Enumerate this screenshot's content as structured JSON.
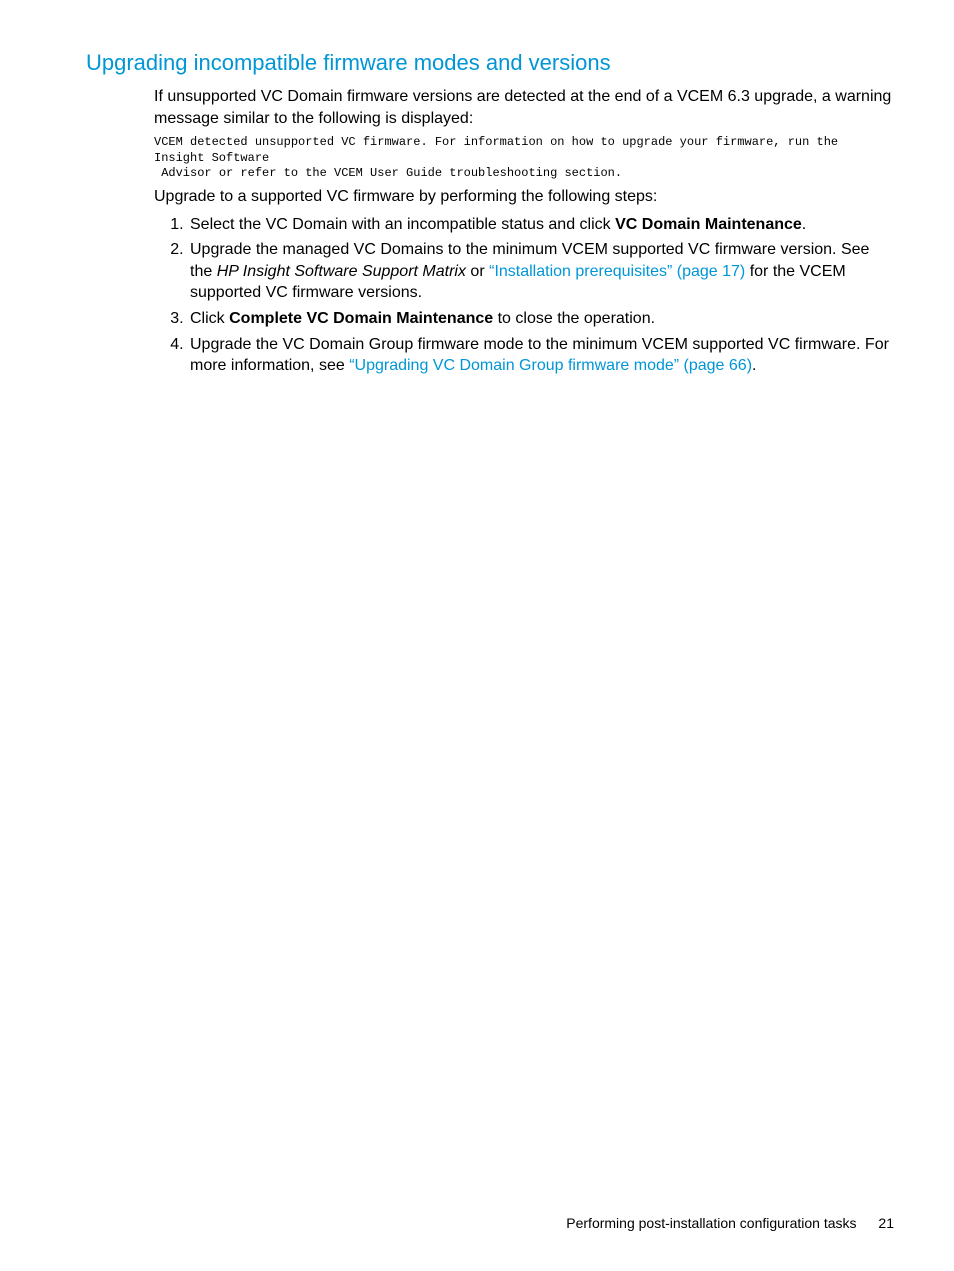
{
  "heading": "Upgrading incompatible firmware modes and versions",
  "intro": "If unsupported VC Domain firmware versions are detected at the end of a VCEM 6.3 upgrade, a warning message similar to the following is displayed:",
  "code": "VCEM detected unsupported VC firmware. For information on how to upgrade your firmware, run the Insight Software\n Advisor or refer to the VCEM User Guide troubleshooting section.",
  "upgrade_line": "Upgrade to a supported VC firmware by performing the following steps:",
  "steps": {
    "s1_a": "Select the VC Domain with an incompatible status and click ",
    "s1_bold": "VC Domain Maintenance",
    "s1_b": ".",
    "s2_a": "Upgrade the managed VC Domains to the minimum VCEM supported VC firmware version. See the ",
    "s2_italic": "HP Insight Software Support Matrix",
    "s2_b": " or ",
    "s2_link": "“Installation prerequisites” (page 17)",
    "s2_c": " for the VCEM supported VC firmware versions.",
    "s3_a": "Click ",
    "s3_bold": "Complete VC Domain Maintenance",
    "s3_b": " to close the operation.",
    "s4_a": "Upgrade the VC Domain Group firmware mode to the minimum VCEM supported VC firmware. For more information, see ",
    "s4_link": "“Upgrading VC Domain Group firmware mode” (page 66)",
    "s4_b": "."
  },
  "footer": {
    "text": "Performing post-installation configuration tasks",
    "page": "21"
  }
}
